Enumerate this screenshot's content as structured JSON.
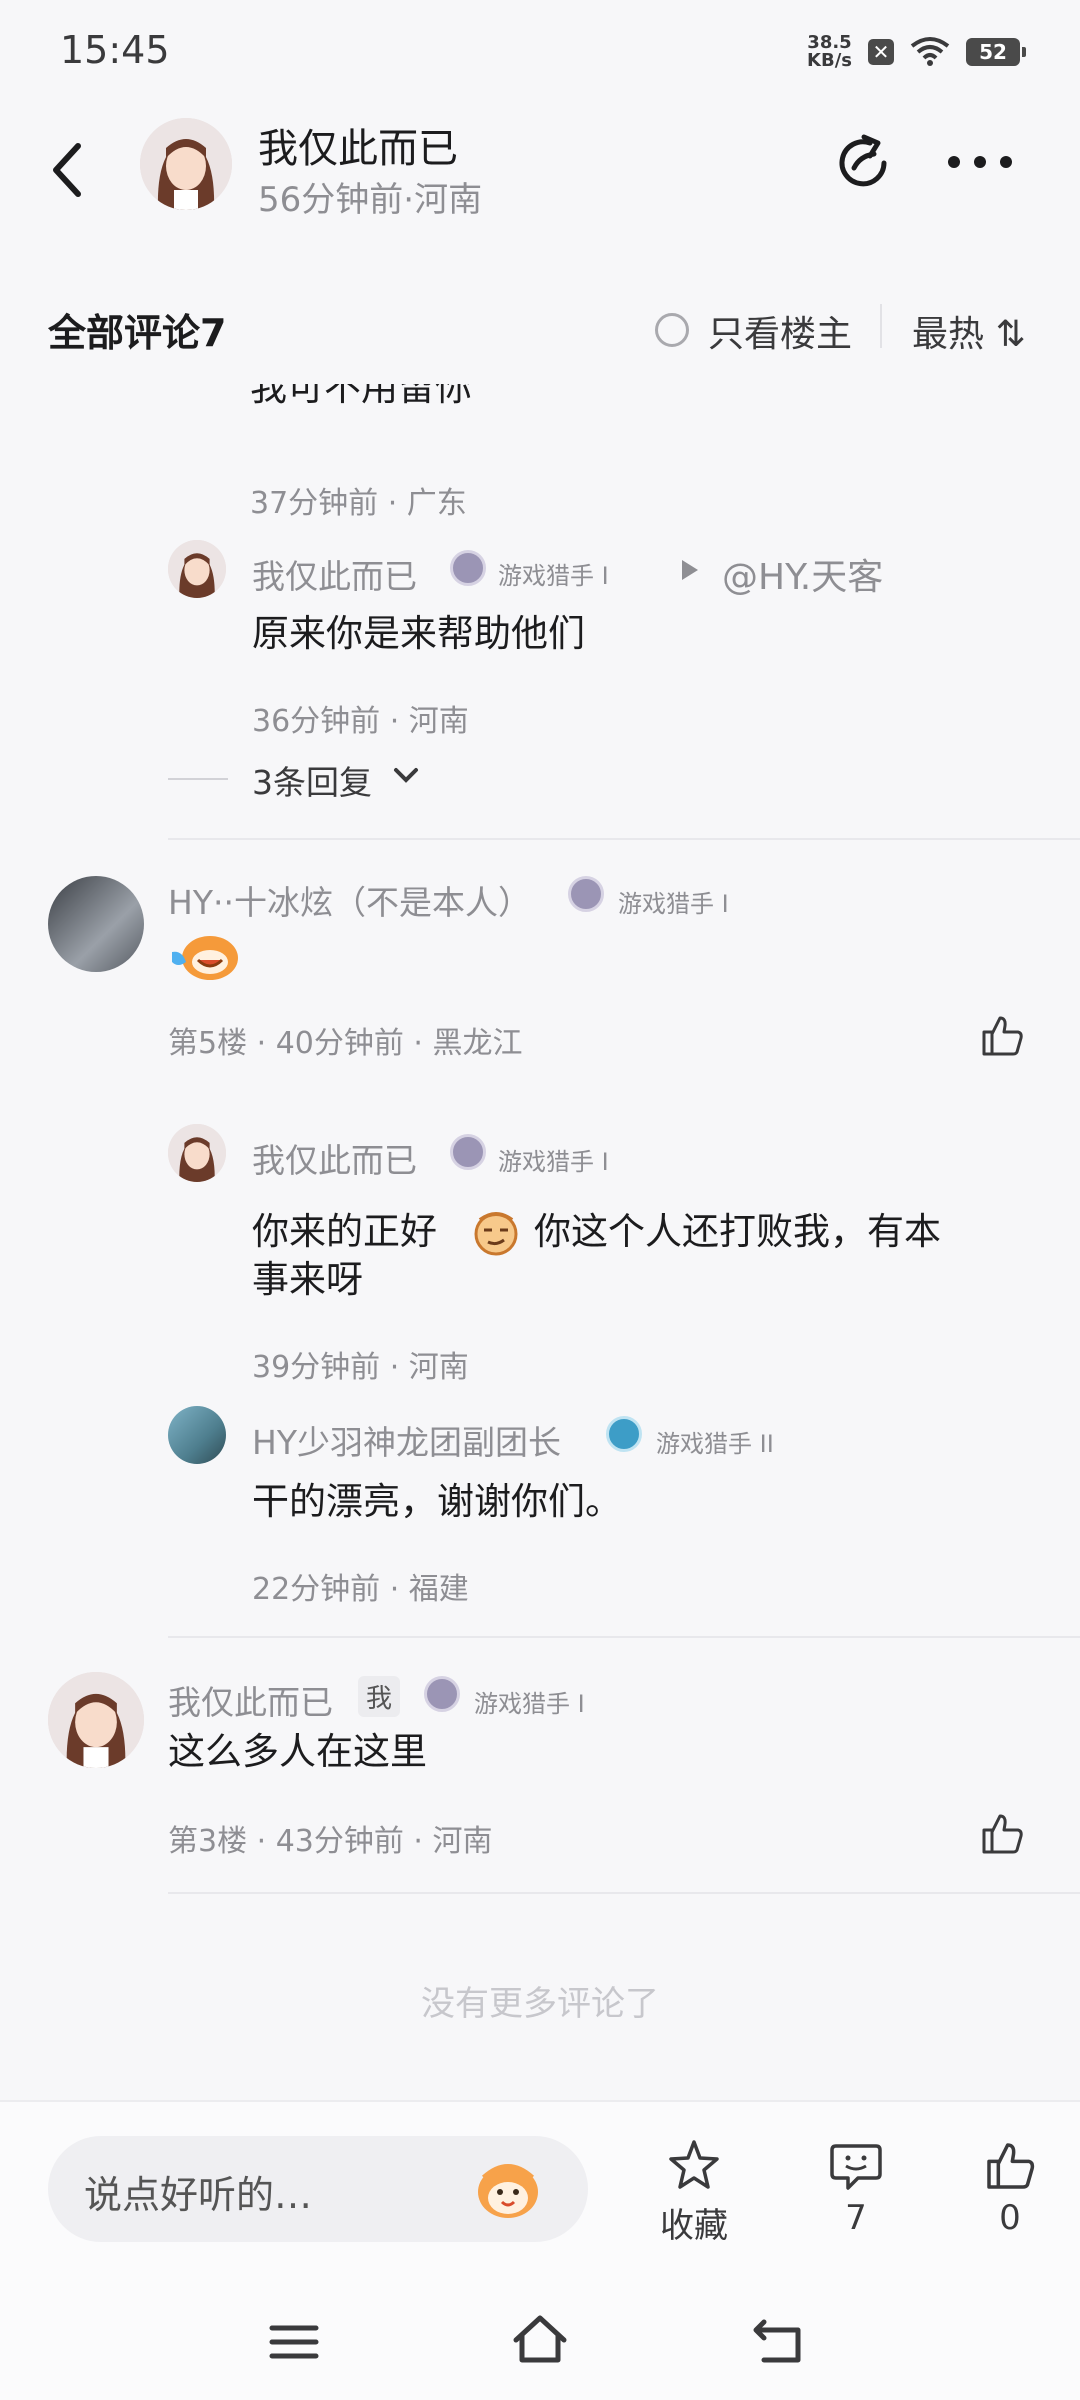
{
  "status": {
    "time": "15:45",
    "speed_value": "38.5",
    "speed_unit": "KB/s",
    "battery": "52"
  },
  "header": {
    "author": "我仅此而已",
    "subtitle": "56分钟前·河南"
  },
  "section": {
    "title": "全部评论7",
    "only_op": "只看楼主",
    "sort": "最热 ⇅"
  },
  "thread": {
    "partial_text": "我可不用留你",
    "partial_meta": "37分钟前 · 广东",
    "reply1": {
      "name": "我仅此而已",
      "badge": "游戏猎手 I",
      "reply_to": "@HY.天客",
      "text": "原来你是来帮助他们",
      "meta": "36分钟前 · 河南"
    },
    "more_replies": "3条回复"
  },
  "comment5": {
    "name": "HY··十冰炫（不是本人）",
    "badge": "游戏猎手 I",
    "meta": "第5楼 · 40分钟前 · 黑龙江",
    "replies": [
      {
        "name": "我仅此而已",
        "badge": "游戏猎手 I",
        "text1": "你来的正好",
        "text2": "你这个人还打败我，有本",
        "text3": "事来呀",
        "meta": "39分钟前 · 河南"
      },
      {
        "name": "HY少羽神龙团副团长",
        "badge": "游戏猎手 II",
        "text": "干的漂亮，谢谢你们。",
        "meta": "22分钟前 · 福建"
      }
    ]
  },
  "comment3": {
    "name": "我仅此而已",
    "me_tag": "我",
    "badge": "游戏猎手 I",
    "text": "这么多人在这里",
    "meta": "第3楼 · 43分钟前 · 河南"
  },
  "end_text": "没有更多评论了",
  "bottom": {
    "placeholder": "说点好听的…",
    "collect": "收藏",
    "comments_count": "7",
    "likes_count": "0"
  },
  "colors": {
    "text": "#1c1c1e",
    "secondary": "#8e8e93",
    "background": "#f7f7f9"
  }
}
